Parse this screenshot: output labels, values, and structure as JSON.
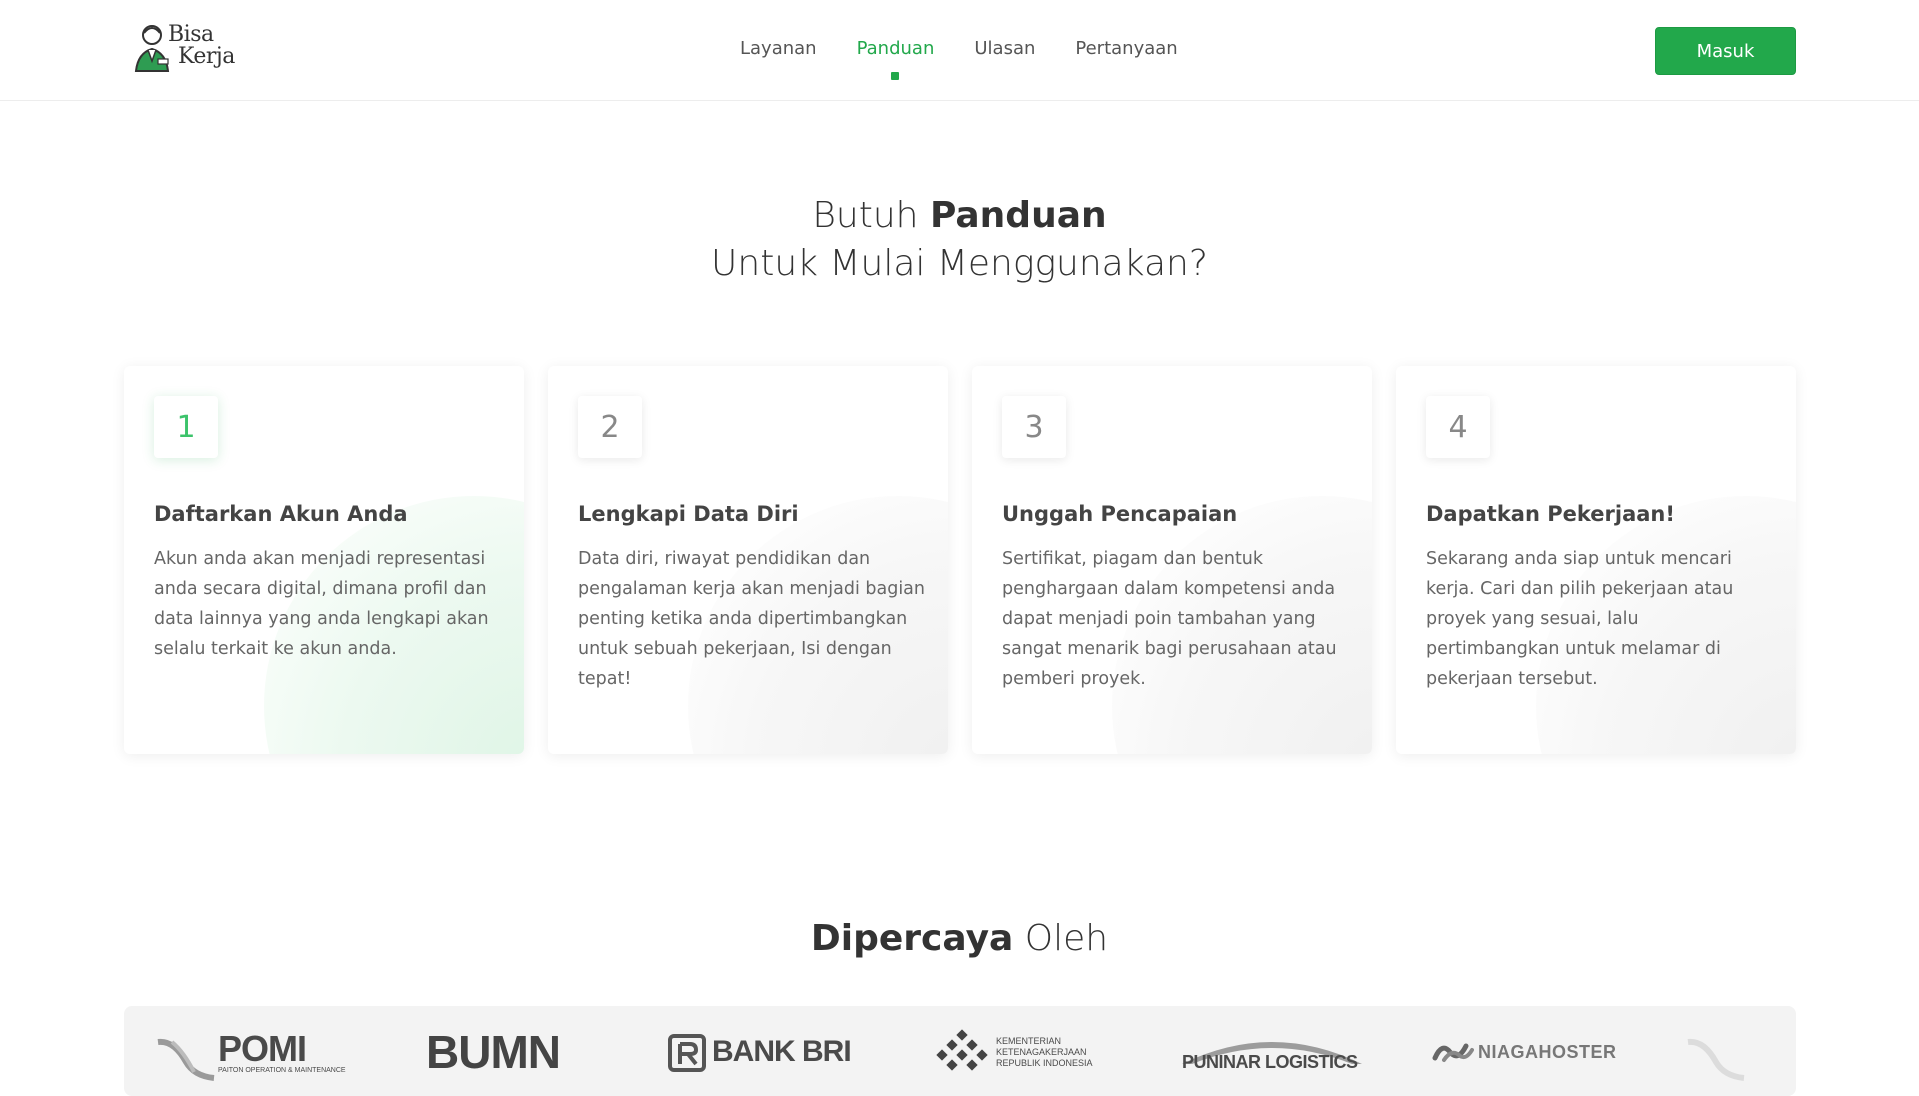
{
  "header": {
    "logo_line1": "Bisa",
    "logo_line2": "Kerja",
    "nav": [
      {
        "label": "Layanan",
        "active": false
      },
      {
        "label": "Panduan",
        "active": true
      },
      {
        "label": "Ulasan",
        "active": false
      },
      {
        "label": "Pertanyaan",
        "active": false
      }
    ],
    "login_label": "Masuk"
  },
  "panduan": {
    "title_pre": "Butuh ",
    "title_bold": "Panduan",
    "title_line2": "Untuk Mulai Menggunakan?",
    "steps": [
      {
        "number": "1",
        "title": "Daftarkan Akun Anda",
        "text": "Akun anda akan menjadi representasi anda secara digital, dimana profil dan data lainnya yang anda lengkapi akan selalu terkait ke akun anda."
      },
      {
        "number": "2",
        "title": "Lengkapi Data Diri",
        "text": "Data diri, riwayat pendidikan dan pengalaman kerja akan menjadi bagian penting ketika anda dipertimbangkan untuk sebuah pekerjaan, Isi dengan tepat!"
      },
      {
        "number": "3",
        "title": "Unggah Pencapaian",
        "text": "Sertifikat, piagam dan bentuk penghargaan dalam kompetensi anda dapat menjadi poin tambahan yang sangat menarik bagi perusahaan atau pemberi proyek."
      },
      {
        "number": "4",
        "title": "Dapatkan Pekerjaan!",
        "text": "Sekarang anda siap untuk mencari kerja. Cari dan pilih pekerjaan atau proyek yang sesuai, lalu pertimbangkan untuk melamar di pekerjaan tersebut."
      }
    ]
  },
  "trusted": {
    "title_bold": "Dipercaya",
    "title_rest": " Oleh",
    "partners": [
      {
        "name": "POMI",
        "sub": "PAITON OPERATION & MAINTENANCE"
      },
      {
        "name": "BUMN"
      },
      {
        "name": "BANK BRI"
      },
      {
        "name": "KEMENTERIAN KETENAGAKERJAAN REPUBLIK INDONESIA"
      },
      {
        "name": "PUNINAR LOGISTICS"
      },
      {
        "name": "NIAGAHOSTER"
      }
    ]
  },
  "colors": {
    "accent": "#22a84b",
    "accent_light": "#3cc36b",
    "text_dark": "#333333",
    "text_muted": "#666666"
  }
}
